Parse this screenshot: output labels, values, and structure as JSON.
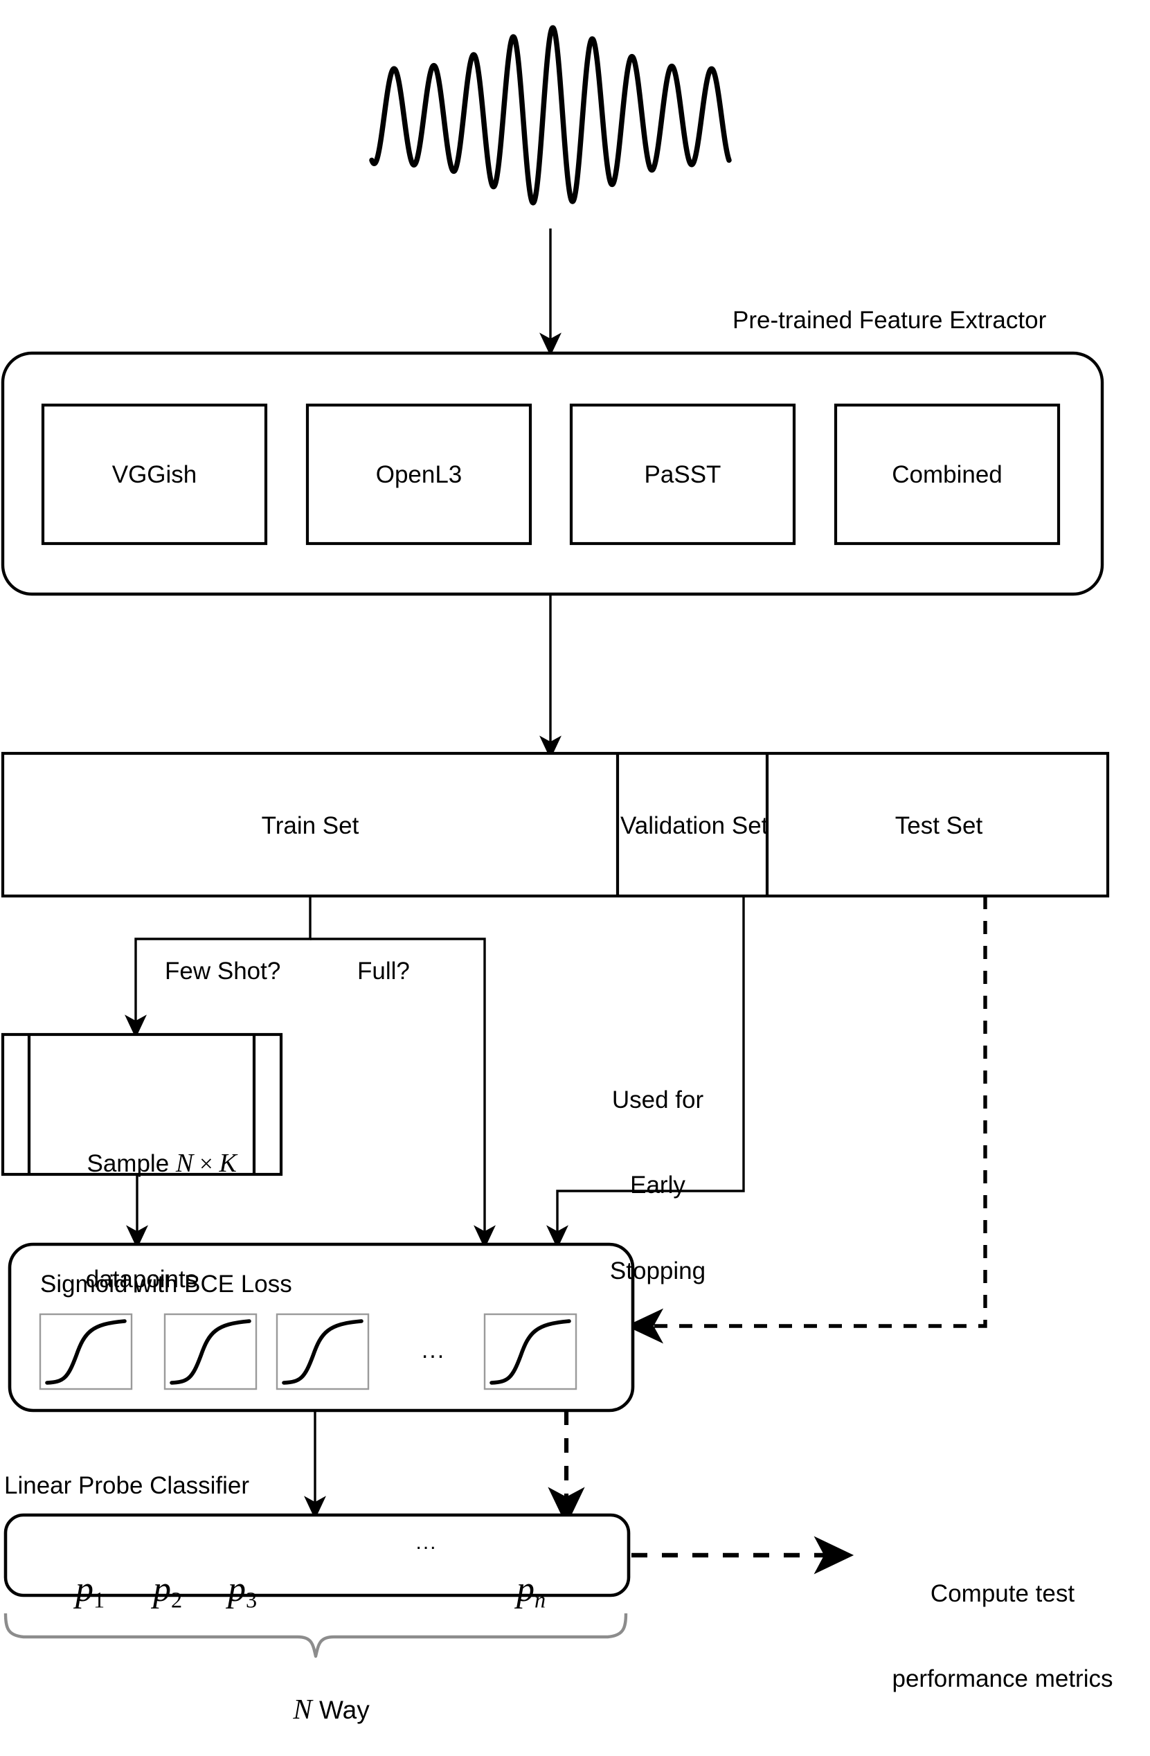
{
  "diagram": {
    "title_visible": false,
    "colors": {
      "stroke": "#000000",
      "background": "#ffffff",
      "thin_box_stroke": "#9a9a9a",
      "brace_stroke": "#8c8c8c"
    },
    "waveform": {
      "name": "audio-waveform",
      "description": "amplitude-modulated sine wave input signal",
      "cycles": 9
    },
    "feature_extractor": {
      "label": "Pre-trained Feature Extractor",
      "models": [
        {
          "label": "VGGish"
        },
        {
          "label": "OpenL3"
        },
        {
          "label": "PaSST"
        },
        {
          "label": "Combined"
        }
      ]
    },
    "dataset_split": {
      "segments": [
        {
          "label": "Train Set"
        },
        {
          "label": "Validation Set"
        },
        {
          "label": "Test Set"
        }
      ]
    },
    "branch_labels": {
      "few_shot": "Few Shot?",
      "full": "Full?"
    },
    "sample_node": {
      "line1_prefix": "Sample ",
      "line1_math_n": "N",
      "line1_math_times": " × ",
      "line1_math_k": "K",
      "line2": "datapoints"
    },
    "validation_note": {
      "line1": "Used for",
      "line2": "Early",
      "line3": "Stopping"
    },
    "loss_block": {
      "label": "Sigmoid with BCE Loss",
      "sigmoid_count_shown": 4,
      "ellipsis": "..."
    },
    "classifier": {
      "label": "Linear Probe Classifier",
      "outputs": [
        {
          "base": "p",
          "sub": "1"
        },
        {
          "base": "p",
          "sub": "2"
        },
        {
          "base": "p",
          "sub": "3"
        },
        {
          "base": "p",
          "sub": "n"
        }
      ],
      "ellipsis": "..."
    },
    "brace_label": {
      "math_n": "N",
      "text": " Way"
    },
    "test_output": {
      "line1": "Compute test",
      "line2": "performance metrics"
    }
  }
}
